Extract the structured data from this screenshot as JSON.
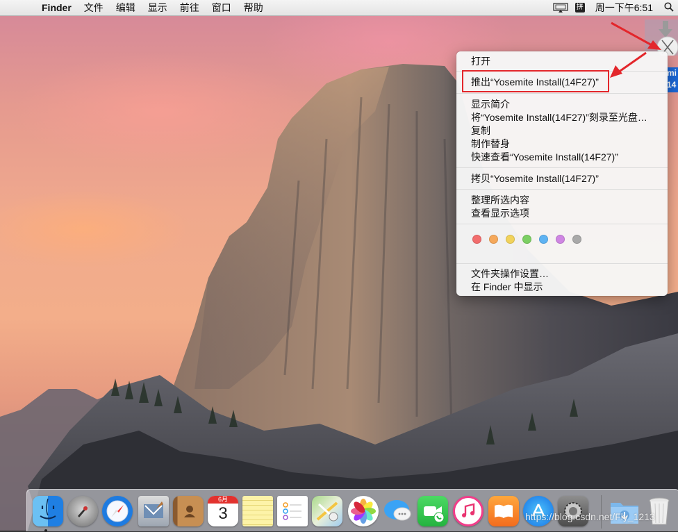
{
  "menubar": {
    "apple": "",
    "app_name": "Finder",
    "items": [
      "文件",
      "编辑",
      "显示",
      "前往",
      "窗口",
      "帮助"
    ],
    "ime": "拼",
    "clock": "周一下午6:51"
  },
  "desktop": {
    "drive_label_lines": [
      "mi",
      "14"
    ]
  },
  "context_menu": {
    "items": [
      "打开",
      "推出“Yosemite Install(14F27)”",
      "显示简介",
      "将“Yosemite Install(14F27)”刻录至光盘…",
      "复制",
      "制作替身",
      "快速查看“Yosemite Install(14F27)”",
      "拷贝“Yosemite Install(14F27)”",
      "整理所选内容",
      "查看显示选项",
      "文件夹操作设置…",
      "在 Finder 中显示"
    ],
    "highlighted_item": "推出“Yosemite Install(14F27)”",
    "tag_colors": [
      "#f26d6d",
      "#f5a85a",
      "#f1d25b",
      "#7ccf63",
      "#5eb3f3",
      "#cf86e3",
      "#a9a9a9"
    ],
    "highlight_box_color": "#e3262b"
  },
  "dock": {
    "apps": [
      "finder-icon",
      "launchpad-icon",
      "safari-icon",
      "mail-icon",
      "contacts-icon",
      "calendar-icon",
      "notes-icon",
      "reminders-icon",
      "maps-icon",
      "photos-icon",
      "messages-icon",
      "facetime-icon",
      "itunes-icon",
      "ibooks-icon",
      "app-store-icon",
      "system-preferences-icon",
      "downloads-folder-icon",
      "trash-icon"
    ],
    "calendar_month": "6月",
    "calendar_day": "3"
  },
  "watermark": "https://blog.csdn.net/Fly_1213"
}
